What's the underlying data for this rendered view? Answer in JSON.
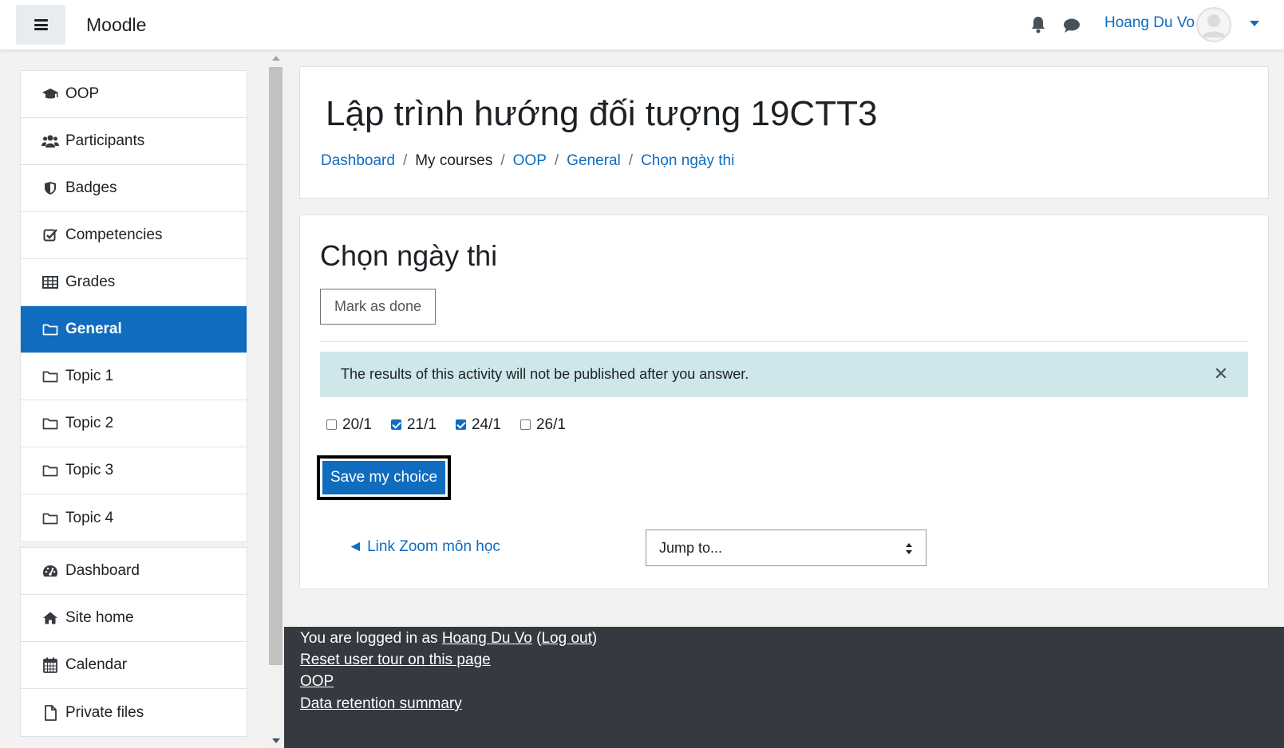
{
  "navbar": {
    "brand": "Moodle",
    "user_name": "Hoang Du Vo",
    "icons": [
      "menu-icon",
      "bell-icon",
      "chat-icon",
      "avatar",
      "caret-down-icon"
    ]
  },
  "sidebar": {
    "course_items": [
      {
        "label": "OOP",
        "icon": "graduation-cap-icon"
      },
      {
        "label": "Participants",
        "icon": "users-icon"
      },
      {
        "label": "Badges",
        "icon": "shield-icon"
      },
      {
        "label": "Competencies",
        "icon": "checkbox-icon"
      },
      {
        "label": "Grades",
        "icon": "table-icon"
      },
      {
        "label": "General",
        "icon": "folder-icon",
        "active": true
      },
      {
        "label": "Topic 1",
        "icon": "folder-icon"
      },
      {
        "label": "Topic 2",
        "icon": "folder-icon"
      },
      {
        "label": "Topic 3",
        "icon": "folder-icon"
      },
      {
        "label": "Topic 4",
        "icon": "folder-icon"
      }
    ],
    "site_items": [
      {
        "label": "Dashboard",
        "icon": "dashboard-icon"
      },
      {
        "label": "Site home",
        "icon": "home-icon"
      },
      {
        "label": "Calendar",
        "icon": "calendar-icon"
      },
      {
        "label": "Private files",
        "icon": "file-icon"
      }
    ]
  },
  "header": {
    "course_title": "Lập trình hướng đối tượng 19CTT3",
    "breadcrumb": [
      {
        "label": "Dashboard",
        "link": true
      },
      {
        "label": "My courses",
        "link": false
      },
      {
        "label": "OOP",
        "link": true
      },
      {
        "label": "General",
        "link": true
      },
      {
        "label": "Chọn ngày thi",
        "link": true
      }
    ],
    "separator": "/"
  },
  "activity": {
    "title": "Chọn ngày thi",
    "mark_done_label": "Mark as done",
    "alert_text": "The results of this activity will not be published after you answer.",
    "options": [
      {
        "label": "20/1",
        "checked": false
      },
      {
        "label": "21/1",
        "checked": true
      },
      {
        "label": "24/1",
        "checked": true
      },
      {
        "label": "26/1",
        "checked": false
      }
    ],
    "save_label": "Save my choice",
    "prev_link": "◄ Link Zoom môn học",
    "jump_to": "Jump to..."
  },
  "footer": {
    "logged_in_prefix": "You are logged in as ",
    "user_name": "Hoang Du Vo",
    "logout_open": " (",
    "logout_label": "Log out",
    "logout_close": ")",
    "reset_tour": "Reset user tour on this page",
    "course_link": "OOP",
    "data_retention": "Data retention summary"
  },
  "colors": {
    "primary": "#0f6cbf",
    "alert_bg": "#cfe6ea",
    "footer_bg": "#343a40",
    "page_bg": "#f2f2f2"
  }
}
